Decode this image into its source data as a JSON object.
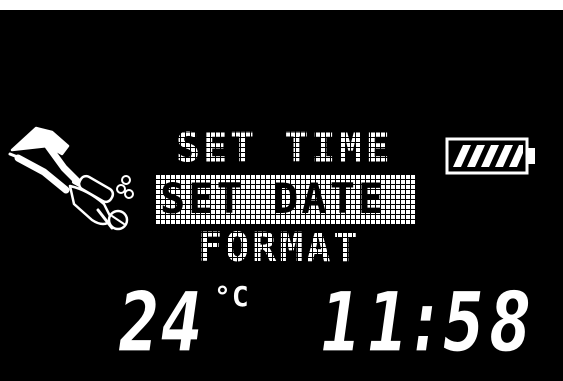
{
  "menu": {
    "items": [
      {
        "label": "SET TIME",
        "selected": false
      },
      {
        "label": "SET DATE",
        "selected": true
      },
      {
        "label": "FORMAT",
        "selected": false
      }
    ]
  },
  "status": {
    "temperature": "24",
    "temperature_unit": "°C",
    "time": "11:58",
    "battery_level": "full",
    "battery_icon": "battery-icon",
    "diver_icon": "diver-icon"
  },
  "colors": {
    "background": "#000000",
    "foreground": "#ffffff"
  }
}
